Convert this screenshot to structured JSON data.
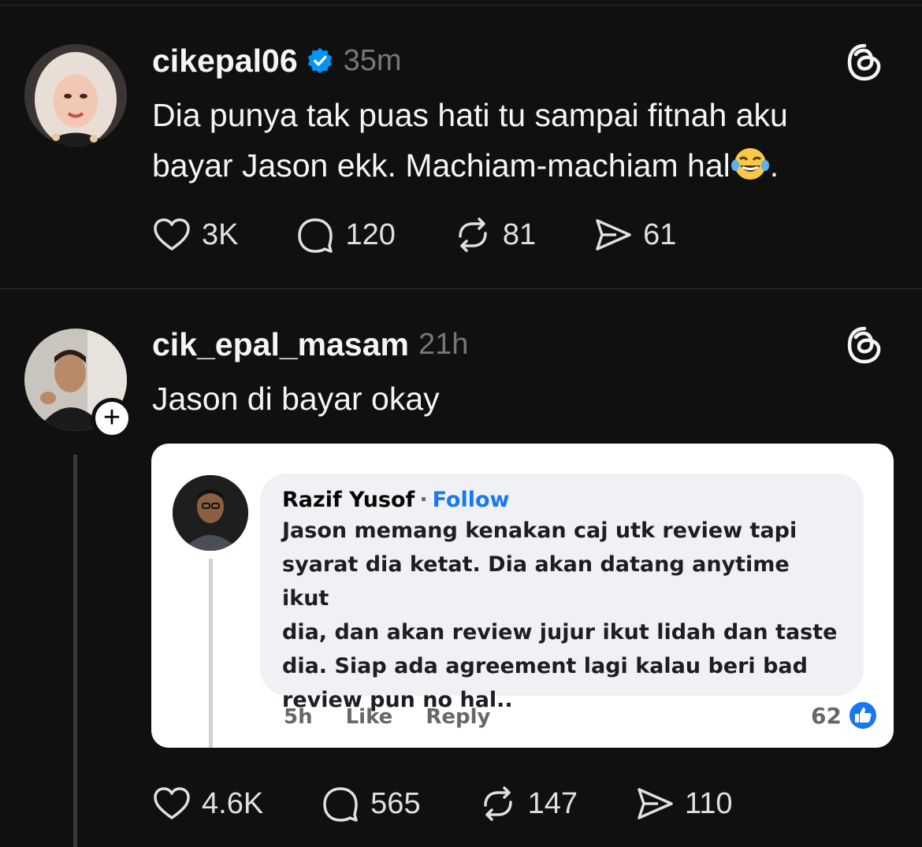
{
  "posts": [
    {
      "username": "cikepal06",
      "verified": true,
      "time": "35m",
      "text_line1": "Dia punya tak puas hati tu sampai fitnah aku",
      "text_line2": "bayar Jason ekk. Machiam-machiam hal",
      "text_after_emoji": ".",
      "emoji": "laughing-tears-emoji",
      "counts": {
        "likes": "3K",
        "replies": "120",
        "reposts": "81",
        "shares": "61"
      }
    },
    {
      "username": "cik_epal_masam",
      "verified": false,
      "time": "21h",
      "text": "Jason di bayar okay",
      "follow_symbol": "+",
      "counts": {
        "likes": "4.6K",
        "replies": "565",
        "reposts": "147",
        "shares": "110"
      }
    }
  ],
  "embedded_comment": {
    "name": "Razif Yusof",
    "dot": "·",
    "follow": "Follow",
    "lines": [
      "Jason memang kenakan caj utk review tapi",
      "syarat dia ketat. Dia akan datang anytime ikut",
      "dia, dan akan review jujur ikut lidah dan taste",
      "dia. Siap ada agreement lagi kalau beri bad",
      "review pun no hal.."
    ],
    "time": "5h",
    "like_label": "Like",
    "reply_label": "Reply",
    "like_count": "62"
  },
  "colors": {
    "background": "#101010",
    "text": "#f3f5f7",
    "muted": "#777777",
    "verified": "#0095f6",
    "fb_blue": "#1877f2"
  },
  "icons": [
    "verified-badge-icon",
    "threads-logo-icon",
    "heart-icon",
    "comment-icon",
    "repost-icon",
    "share-icon",
    "fb-like-icon"
  ]
}
